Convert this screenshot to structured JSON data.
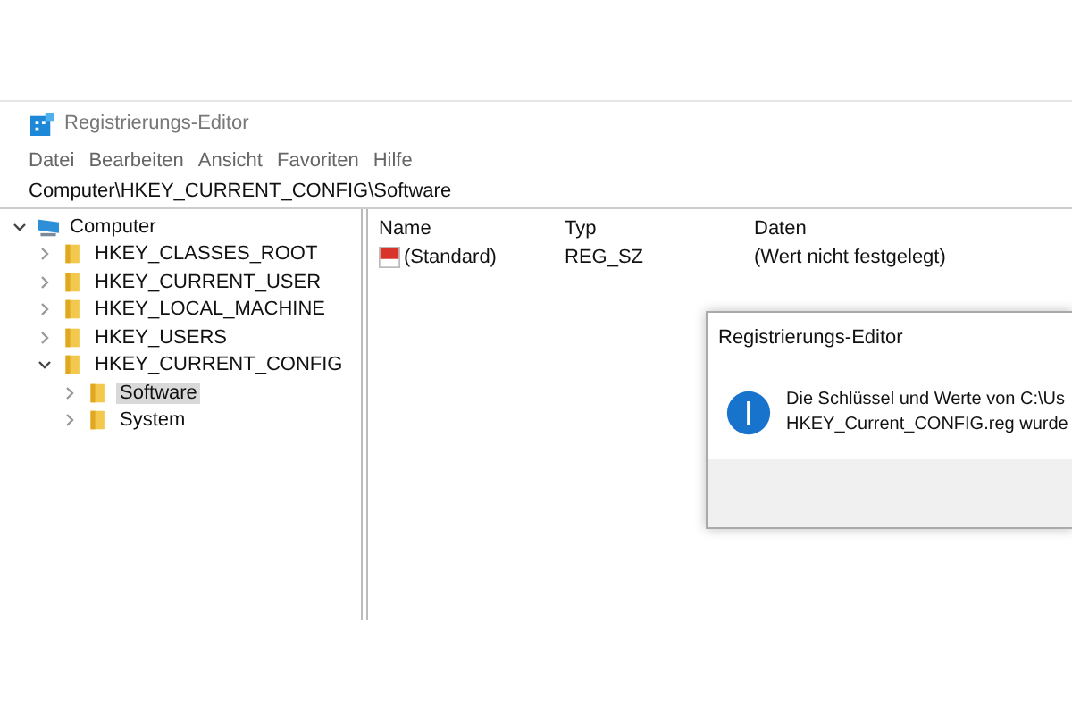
{
  "window": {
    "title": "Registrierungs-Editor"
  },
  "menu": [
    "Datei",
    "Bearbeiten",
    "Ansicht",
    "Favoriten",
    "Hilfe"
  ],
  "address": "Computer\\HKEY_CURRENT_CONFIG\\Software",
  "tree": [
    {
      "label": "Computer",
      "kind": "computer",
      "expanded": true,
      "selected": false,
      "children": [
        {
          "label": "HKEY_CLASSES_ROOT",
          "kind": "folder",
          "expanded": false,
          "selected": false
        },
        {
          "label": "HKEY_CURRENT_USER",
          "kind": "folder",
          "expanded": false,
          "selected": false
        },
        {
          "label": "HKEY_LOCAL_MACHINE",
          "kind": "folder",
          "expanded": false,
          "selected": false
        },
        {
          "label": "HKEY_USERS",
          "kind": "folder",
          "expanded": false,
          "selected": false
        },
        {
          "label": "HKEY_CURRENT_CONFIG",
          "kind": "folder",
          "expanded": true,
          "selected": false,
          "children": [
            {
              "label": "Software",
              "kind": "folder",
              "expanded": false,
              "selected": true
            },
            {
              "label": "System",
              "kind": "folder",
              "expanded": false,
              "selected": false
            }
          ]
        }
      ]
    }
  ],
  "table": {
    "columns": [
      "Name",
      "Typ",
      "Daten"
    ],
    "rows": [
      {
        "name": "(Standard)",
        "type": "REG_SZ",
        "data": "(Wert nicht festgelegt)"
      }
    ]
  },
  "dialog": {
    "title": "Registrierungs-Editor",
    "lines": [
      "Die Schlüssel und Werte von C:\\Us",
      "HKEY_Current_CONFIG.reg wurde"
    ]
  }
}
